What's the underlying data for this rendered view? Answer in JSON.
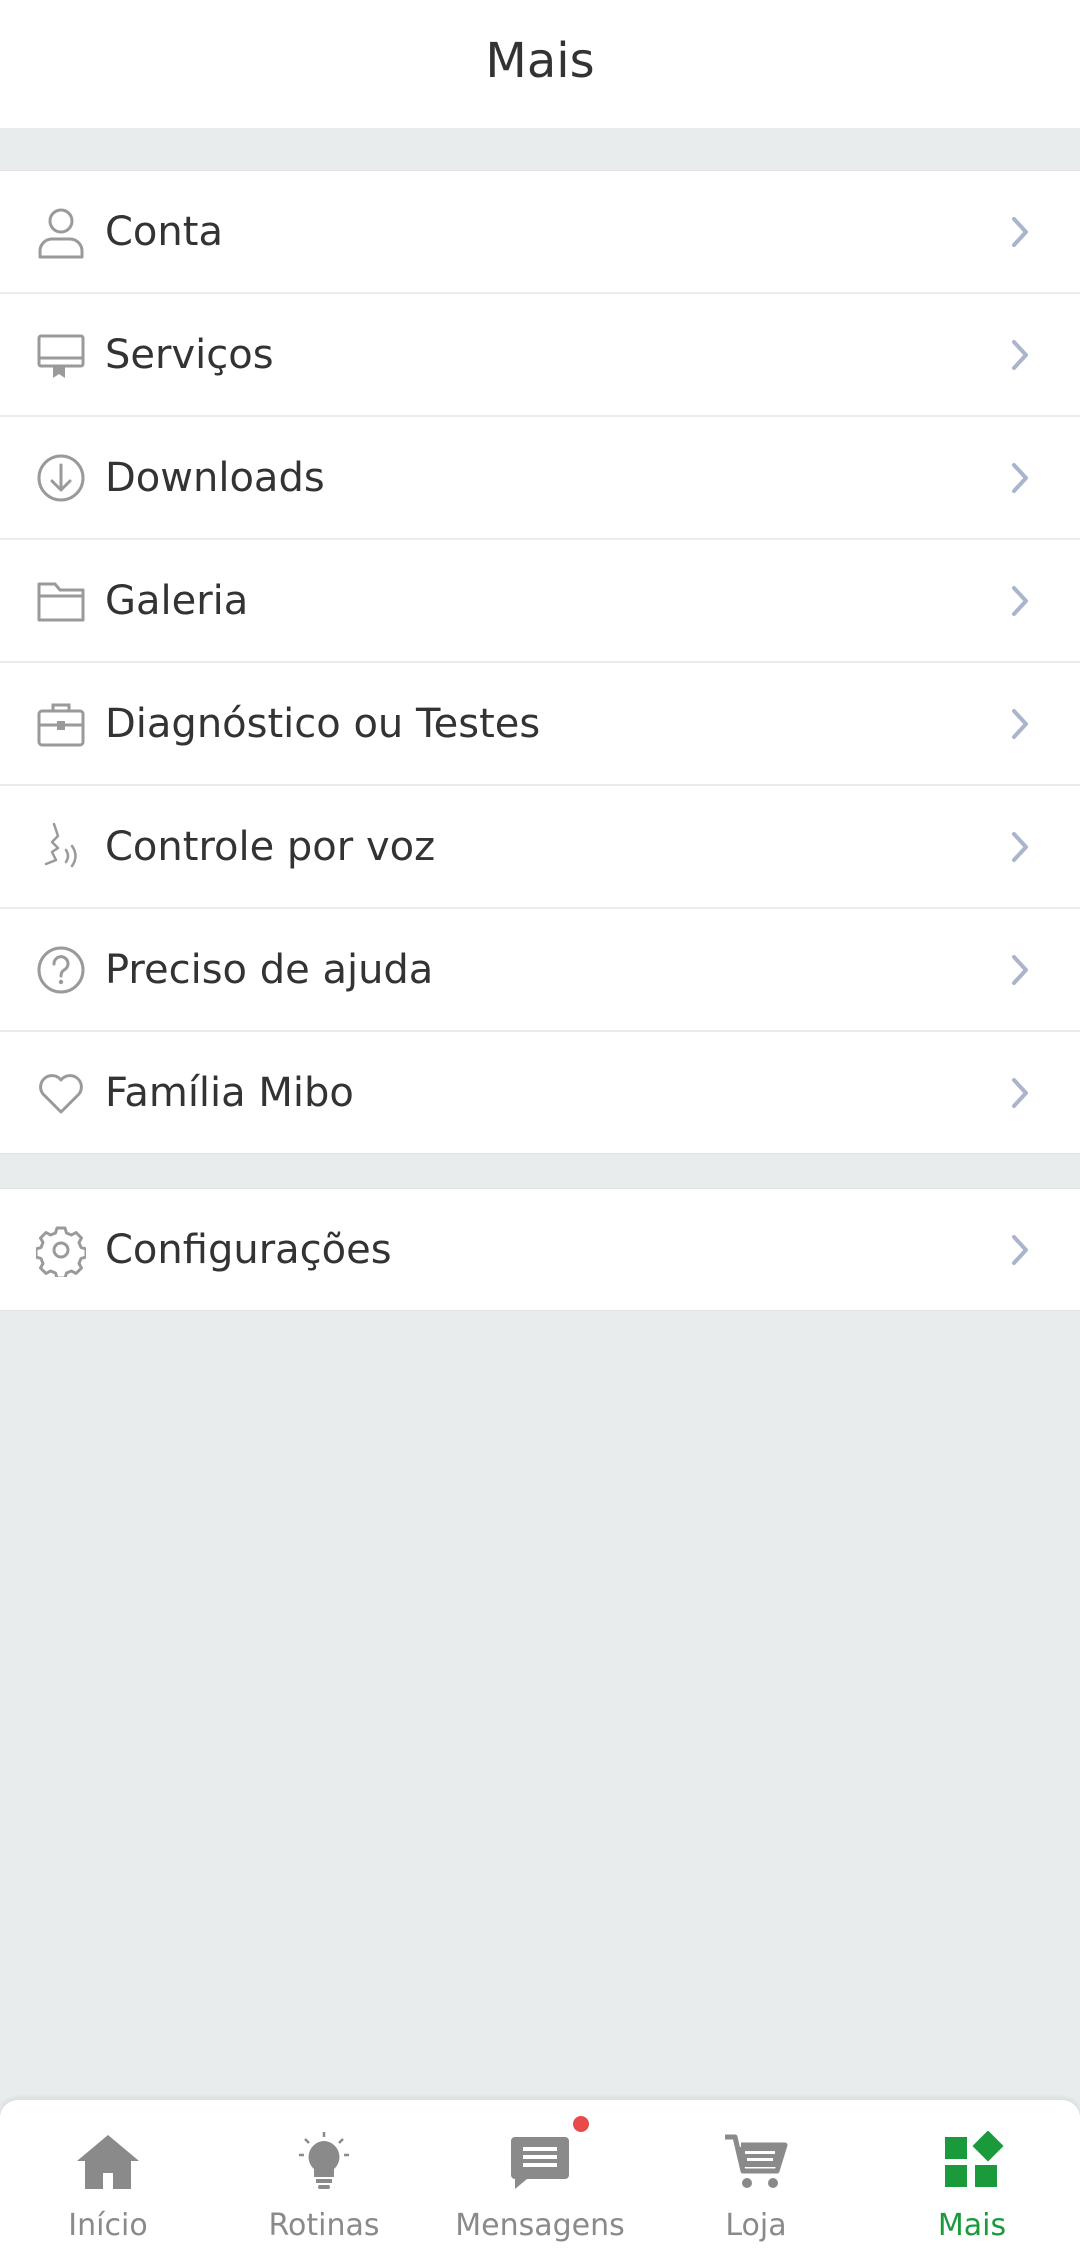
{
  "header": {
    "title": "Mais"
  },
  "menu": [
    {
      "label": "Conta",
      "icon": "user-icon"
    },
    {
      "label": "Serviços",
      "icon": "services-icon"
    },
    {
      "label": "Downloads",
      "icon": "download-icon"
    },
    {
      "label": "Galeria",
      "icon": "folder-icon"
    },
    {
      "label": "Diagnóstico ou Testes",
      "icon": "toolbox-icon"
    },
    {
      "label": "Controle por voz",
      "icon": "voice-icon"
    },
    {
      "label": "Preciso de ajuda",
      "icon": "help-icon"
    },
    {
      "label": "Família Mibo",
      "icon": "heart-icon"
    }
  ],
  "settings": {
    "label": "Configurações",
    "icon": "gear-icon"
  },
  "tabbar": {
    "items": [
      {
        "label": "Início",
        "icon": "home-icon"
      },
      {
        "label": "Rotinas",
        "icon": "lightbulb-icon"
      },
      {
        "label": "Mensagens",
        "icon": "message-icon",
        "badge": true
      },
      {
        "label": "Loja",
        "icon": "cart-icon"
      },
      {
        "label": "Mais",
        "icon": "grid-icon",
        "active": true
      }
    ]
  },
  "colors": {
    "accent": "#1b9a3c",
    "badge": "#e84b4b",
    "icon_gray": "#9a9a9a",
    "chevron": "#aab4cc"
  }
}
